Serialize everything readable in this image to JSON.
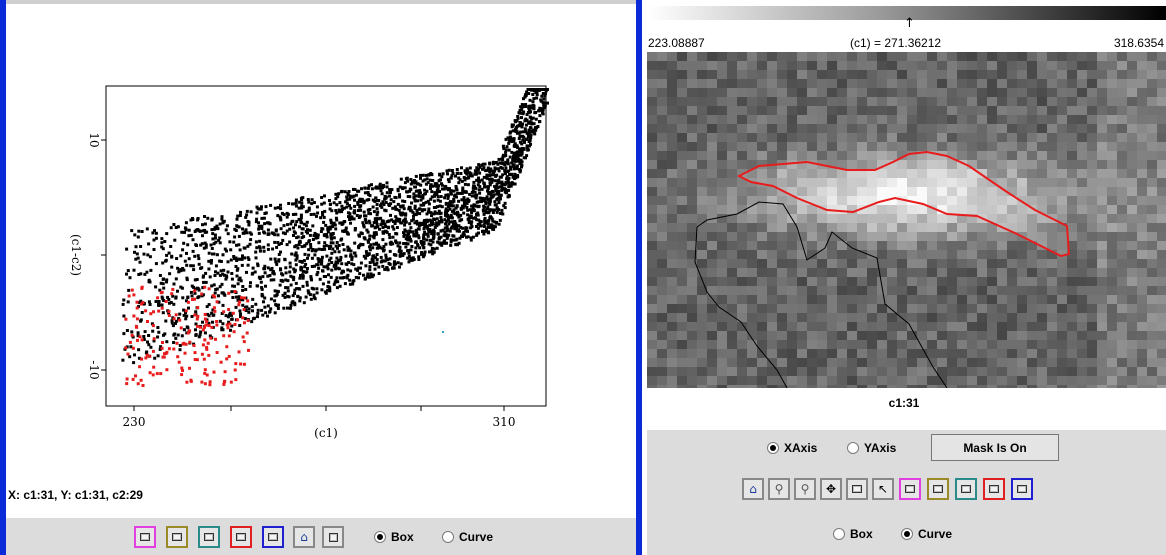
{
  "colors": {
    "accent_border": "#0b2bd8",
    "scatter_main": "#000000",
    "scatter_selected": "#e81c1c",
    "selection_curve": "#e81c1c",
    "coastline": "#000000",
    "toolbar_bg": "#dcdcdc"
  },
  "scatter_plot": {
    "xlabel": "(c1)",
    "ylabel": "(c1-c2)",
    "x_ticks": [
      "230",
      "310"
    ],
    "y_ticks": [
      "10",
      "-10"
    ]
  },
  "left_panel": {
    "status": "X: c1:31,  Y: c1:31, c2:29",
    "toolbar": {
      "color_buttons": [
        {
          "name": "magenta-box-button",
          "color": "#e040e0"
        },
        {
          "name": "olive-box-button",
          "color": "#9a8a2a"
        },
        {
          "name": "teal-box-button",
          "color": "#2a8a8a"
        },
        {
          "name": "red-box-button",
          "color": "#e02020"
        },
        {
          "name": "blue-box-button",
          "color": "#2020d0"
        }
      ],
      "home_icon": "home-icon",
      "square_icon": "square-icon",
      "mode_box_label": "Box",
      "mode_curve_label": "Curve",
      "mode_selected": "Box"
    }
  },
  "right_panel": {
    "colorbar": {
      "min": "223.08887",
      "current": "(c1) = 271.36212",
      "max": "318.6354",
      "arrow": "↑"
    },
    "image_caption": "c1:31",
    "axis_xaxis_label": "XAxis",
    "axis_yaxis_label": "YAxis",
    "axis_selected": "XAxis",
    "mask_button_label": "Mask Is On",
    "toolbar": {
      "tool_icons": [
        "home-icon",
        "zoom-in-icon",
        "zoom-out-icon",
        "pan-icon",
        "square-icon",
        "pointer-icon"
      ],
      "color_buttons": [
        {
          "name": "magenta-box-button",
          "color": "#e040e0"
        },
        {
          "name": "olive-box-button",
          "color": "#9a8a2a"
        },
        {
          "name": "teal-box-button",
          "color": "#2a8a8a"
        },
        {
          "name": "red-box-button",
          "color": "#e02020"
        },
        {
          "name": "blue-box-button",
          "color": "#2020d0"
        }
      ]
    },
    "mode_box_label": "Box",
    "mode_curve_label": "Curve",
    "mode_selected": "Curve"
  }
}
